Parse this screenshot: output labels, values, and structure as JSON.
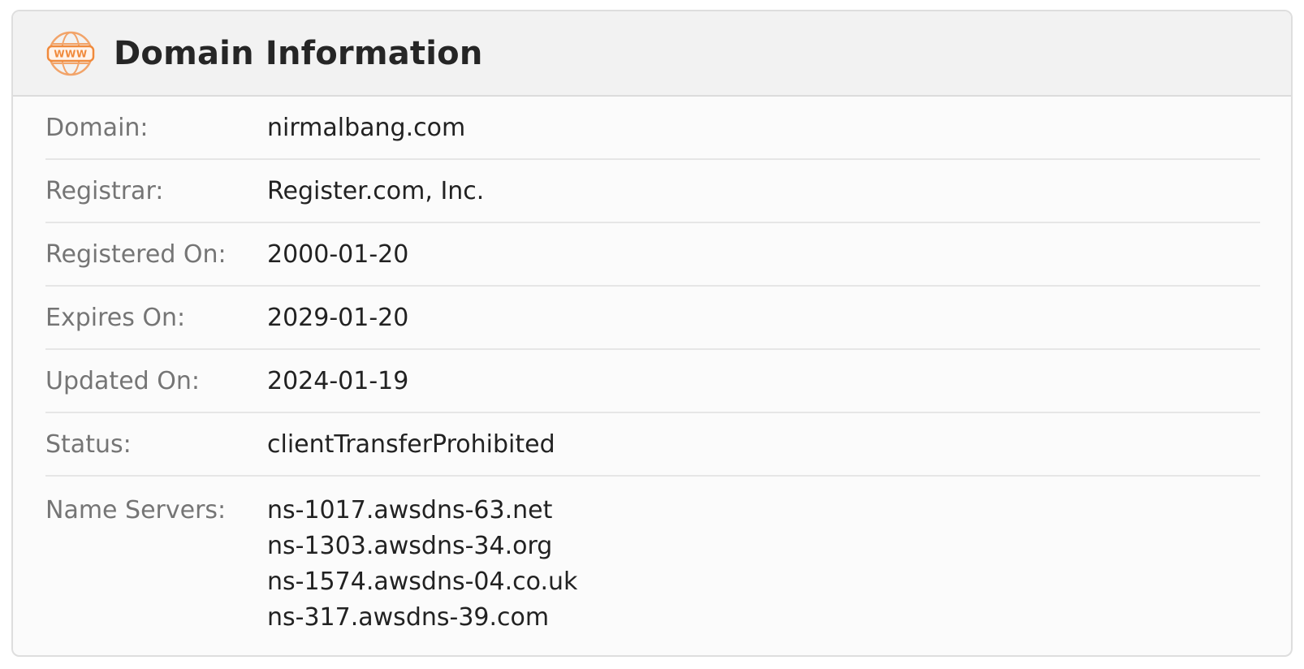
{
  "card": {
    "title": "Domain Information",
    "icon": "www-globe-icon",
    "accent_color": "#f08a3c"
  },
  "fields": [
    {
      "label": "Domain:",
      "value": "nirmalbang.com"
    },
    {
      "label": "Registrar:",
      "value": "Register.com, Inc."
    },
    {
      "label": "Registered On:",
      "value": "2000-01-20"
    },
    {
      "label": "Expires On:",
      "value": "2029-01-20"
    },
    {
      "label": "Updated On:",
      "value": "2024-01-19"
    },
    {
      "label": "Status:",
      "value": "clientTransferProhibited"
    }
  ],
  "name_servers": {
    "label": "Name Servers:",
    "values": [
      "ns-1017.awsdns-63.net",
      "ns-1303.awsdns-34.org",
      "ns-1574.awsdns-04.co.uk",
      "ns-317.awsdns-39.com"
    ]
  }
}
